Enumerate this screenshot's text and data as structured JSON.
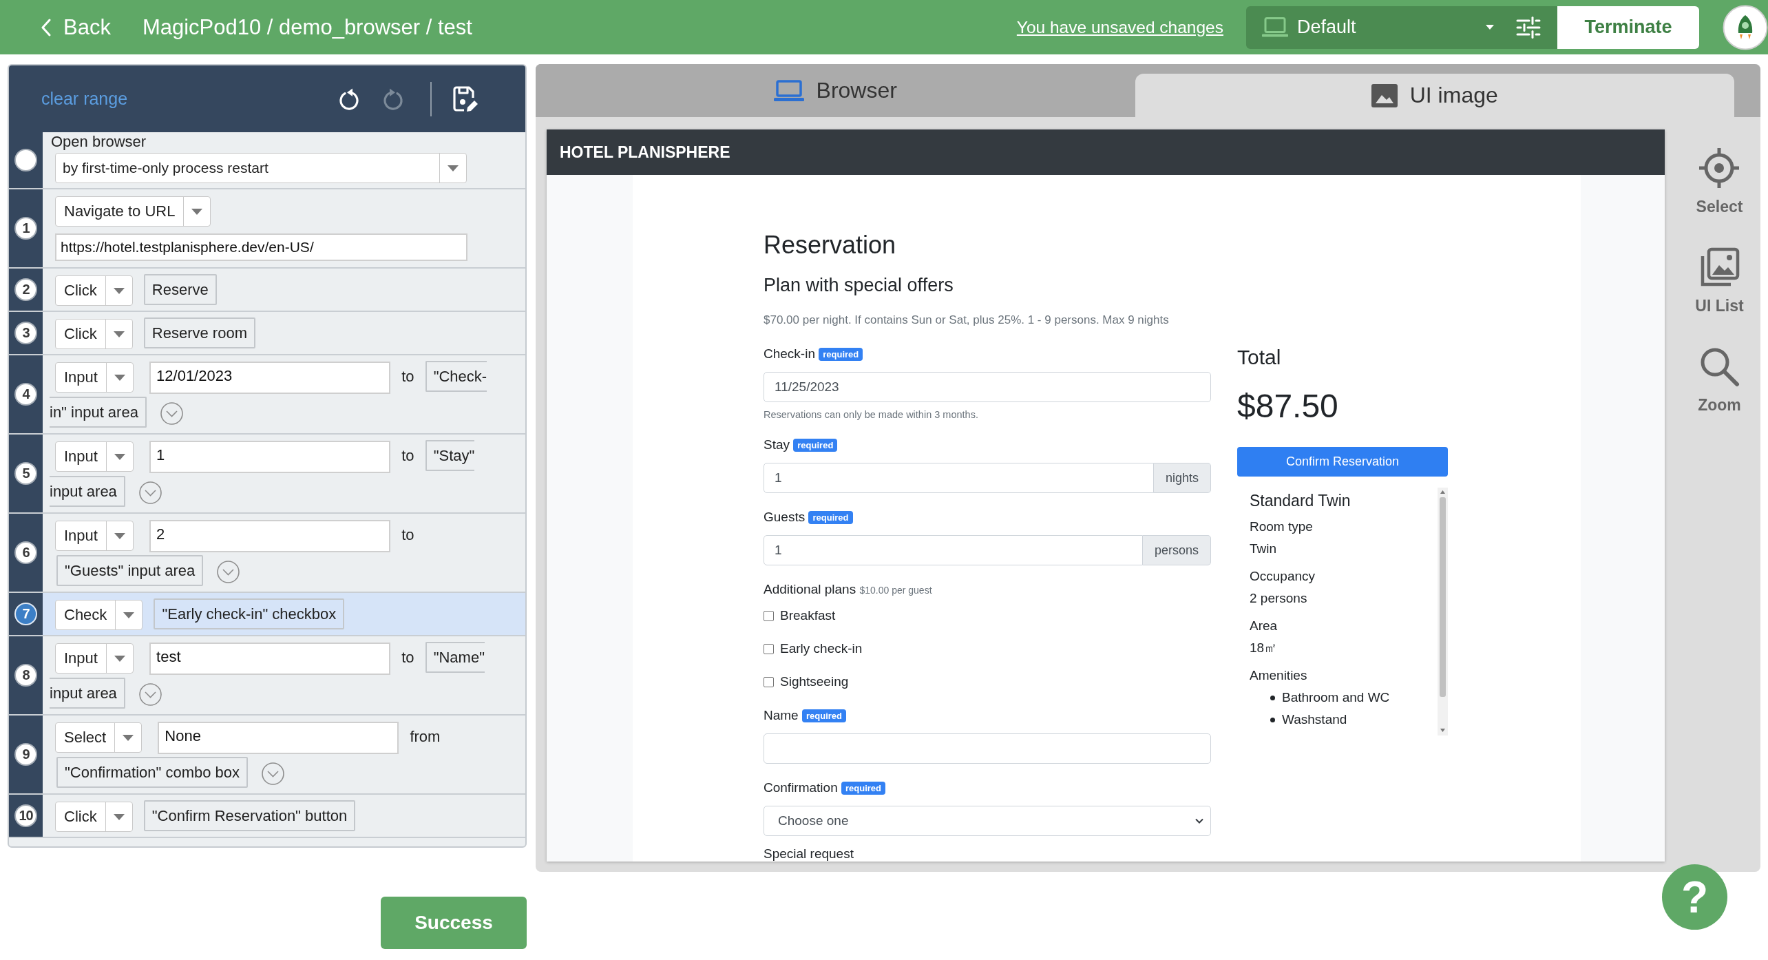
{
  "top_bar": {
    "back": "Back",
    "breadcrumb": "MagicPod10 / demo_browser / test",
    "unsaved_notice": "You have unsaved changes",
    "environment": "Default",
    "terminate_button": "Terminate"
  },
  "editor": {
    "clear_range": "clear range",
    "toolbar": [
      {
        "kind": "undo",
        "disabled": false
      },
      {
        "kind": "redo",
        "disabled": true
      },
      {
        "kind": "save",
        "disabled": false
      }
    ],
    "steps": [
      {
        "kind": "start",
        "title": "Open browser",
        "command": "by first-time-only process restart",
        "selected": false
      },
      {
        "kind": "url",
        "number": "1",
        "command": "Navigate to URL",
        "value": "https://hotel.testplanisphere.dev/en-US/",
        "selected": false
      },
      {
        "kind": "element",
        "number": "2",
        "command": "Click",
        "target": "Reserve",
        "selected": false
      },
      {
        "kind": "element",
        "number": "3",
        "command": "Click",
        "target": "Reserve room",
        "selected": false
      },
      {
        "kind": "value",
        "number": "4",
        "command": "Input",
        "value": "12/01/2023",
        "connector": "to",
        "target": "\"Check-in\" input area",
        "selected": false
      },
      {
        "kind": "value",
        "number": "5",
        "command": "Input",
        "value": "1",
        "connector": "to",
        "target": "\"Stay\" input area",
        "selected": false
      },
      {
        "kind": "value",
        "number": "6",
        "command": "Input",
        "value": "2",
        "connector": "to",
        "target": "\"Guests\" input area",
        "selected": false
      },
      {
        "kind": "element",
        "number": "7",
        "command": "Check",
        "target": "\"Early check-in\" checkbox",
        "selected": true
      },
      {
        "kind": "value",
        "number": "8",
        "command": "Input",
        "value": "test",
        "connector": "to",
        "target": "\"Name\" input area",
        "selected": false
      },
      {
        "kind": "value",
        "number": "9",
        "command": "Select",
        "value": "None",
        "connector": "from",
        "target": "\"Confirmation\" combo box",
        "selected": false
      },
      {
        "kind": "element",
        "number": "10",
        "command": "Click",
        "target": "\"Confirm Reservation\" button",
        "selected": false
      }
    ]
  },
  "run_button": "Success",
  "preview": {
    "tabs": [
      {
        "kind": "browser",
        "label": "Browser",
        "selected": false
      },
      {
        "kind": "image",
        "label": "UI image",
        "selected": true
      }
    ],
    "page": {
      "site_title": "HOTEL PLANISPHERE",
      "heading": "Reservation",
      "plan_name": "Plan with special offers",
      "plan_info": "$70.00 per night. If contains Sun or Sat, plus 25%. 1 - 9 persons. Max 9 nights",
      "fields": [
        {
          "kind": "date",
          "label": "Check-in",
          "badge": "required",
          "value": "11/25/2023",
          "help": "Reservations can only be made within 3 months."
        },
        {
          "kind": "number",
          "label": "Stay",
          "badge": "required",
          "value": "1",
          "unit": "nights"
        },
        {
          "kind": "number",
          "label": "Guests",
          "badge": "required",
          "value": "1",
          "unit": "persons"
        },
        {
          "kind": "checks",
          "label": "Additional plans",
          "note": "$10.00 per guest",
          "options": [
            {
              "label": "Breakfast",
              "checked": false
            },
            {
              "label": "Early check-in",
              "checked": false
            },
            {
              "label": "Sightseeing",
              "checked": false
            }
          ]
        },
        {
          "kind": "text",
          "label": "Name",
          "badge": "required"
        },
        {
          "kind": "select",
          "label": "Confirmation",
          "badge": "required",
          "value": "Choose one"
        },
        {
          "kind": "label",
          "label": "Special request"
        }
      ],
      "total_label": "Total",
      "total": "$87.50",
      "confirm_button": "Confirm Reservation",
      "room": {
        "name": "Standard Twin",
        "details": [
          {
            "term": "Room type",
            "value": "Twin"
          },
          {
            "term": "Occupancy",
            "value": "2 persons"
          },
          {
            "term": "Area",
            "value": "18㎡"
          }
        ],
        "amenities_label": "Amenities",
        "amenities": [
          "Bathroom and WC",
          "Washstand"
        ]
      }
    },
    "tools": [
      {
        "kind": "select",
        "label": "Select"
      },
      {
        "kind": "list",
        "label": "UI List"
      },
      {
        "kind": "zoom",
        "label": "Zoom"
      }
    ]
  },
  "help_button": "?"
}
